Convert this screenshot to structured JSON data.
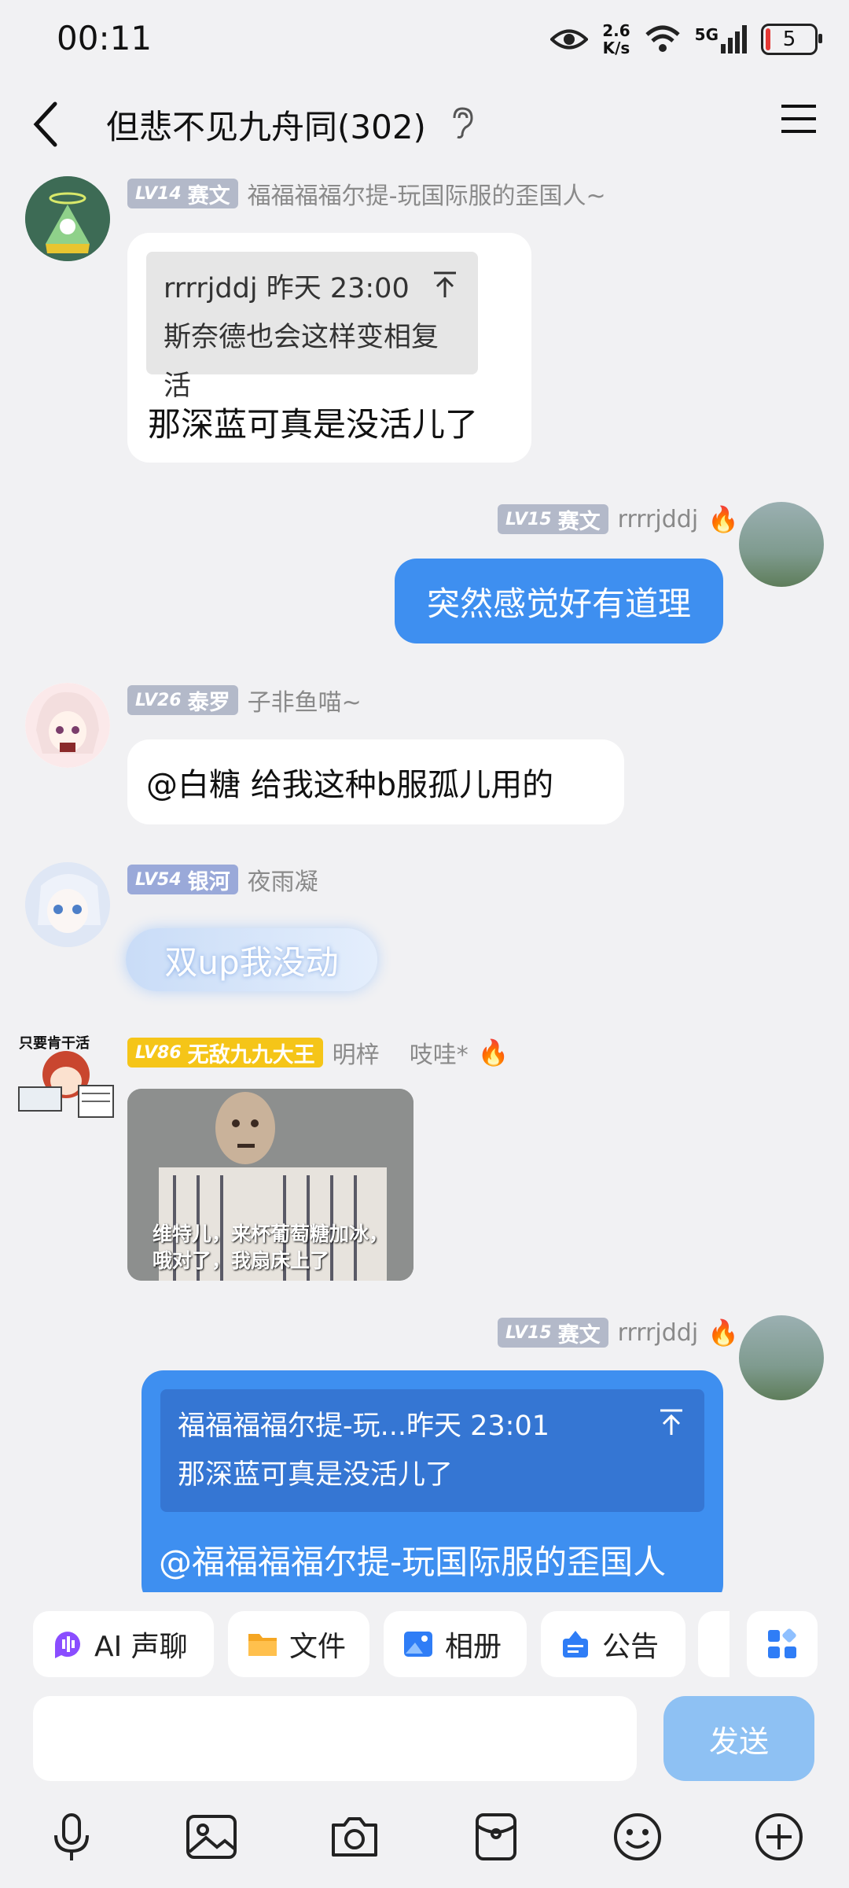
{
  "status_bar": {
    "time": "00:11",
    "net_speed_value": "2.6",
    "net_speed_unit": "K/s",
    "network": "5G",
    "battery": "5"
  },
  "header": {
    "title": "但悲不见九舟同(302)"
  },
  "messages": [
    {
      "level": "LV14",
      "title": "赛文",
      "nick": "福福福福尔提-玩国际服的歪国人~",
      "quote_author": "rrrrjddj 昨天 23:00",
      "quote_text": "斯奈德也会这样变相复活",
      "text": "那深蓝可真是没活儿了"
    },
    {
      "level": "LV15",
      "title": "赛文",
      "nick": "rrrrjddj",
      "text": "突然感觉好有道理"
    },
    {
      "level": "LV26",
      "title": "泰罗",
      "nick": "子非鱼喵~",
      "text": "@白糖 给我这种b服孤儿用的"
    },
    {
      "level": "LV54",
      "title": "银河",
      "nick": "夜雨凝",
      "text": "双up我没动"
    },
    {
      "level": "LV86",
      "title": "无敌九九大王",
      "nick": "明梓    吱哇*",
      "avatar_caption": "只要肯干活",
      "image_caption": "维特儿，来杯葡萄糖加冰，哦对了，我扇床上了"
    },
    {
      "level": "LV15",
      "title": "赛文",
      "nick": "rrrrjddj",
      "quote_author": "福福福福尔提-玩...昨天 23:01",
      "quote_text": "那深蓝可真是没活儿了",
      "text": "@福福福福尔提-玩国际服的歪国人"
    }
  ],
  "toolbar_chips": [
    {
      "label": "AI 声聊",
      "icon": "ai-voice-icon",
      "color": "#8a4dff"
    },
    {
      "label": "文件",
      "icon": "folder-icon",
      "color": "#f5a623"
    },
    {
      "label": "相册",
      "icon": "album-icon",
      "color": "#2f7df6"
    },
    {
      "label": "公告",
      "icon": "announcement-icon",
      "color": "#2f7df6"
    }
  ],
  "composer": {
    "send_label": "发送"
  },
  "bottom_tools": [
    "microphone-icon",
    "image-icon",
    "camera-icon",
    "red-packet-icon",
    "emoji-icon",
    "plus-icon"
  ],
  "colors": {
    "accent": "#3e8ff0",
    "background": "#f1f1f3",
    "gold_badge": "#f5c518"
  }
}
